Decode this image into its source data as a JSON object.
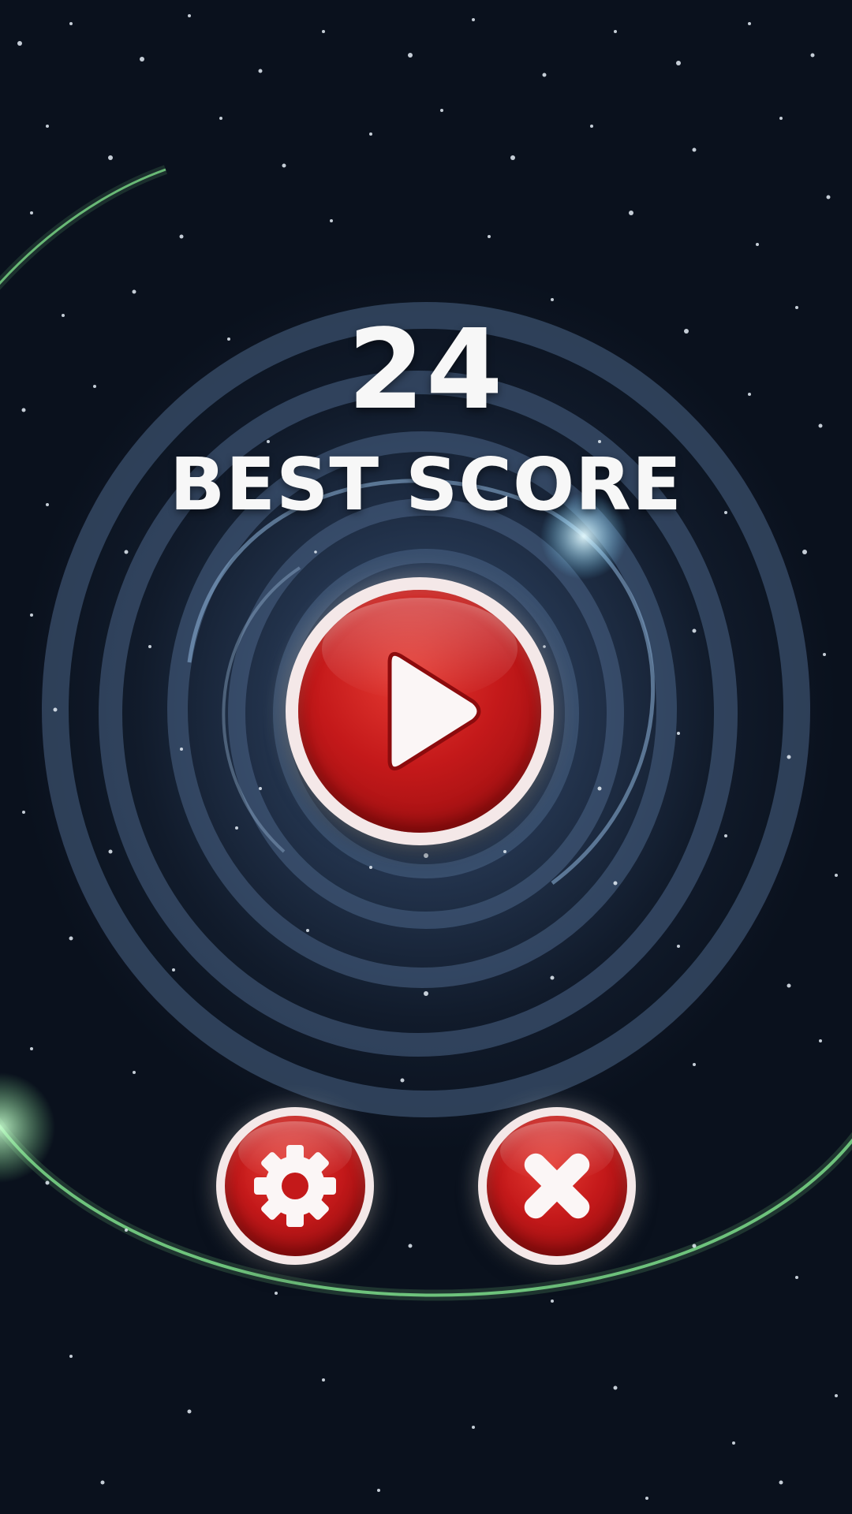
{
  "score": {
    "value": "24",
    "label": "BEST SCORE"
  },
  "buttons": {
    "play_icon": "play-icon",
    "settings_icon": "gear-icon",
    "close_icon": "close-icon"
  },
  "colors": {
    "button_red": "#c4191a",
    "button_rim": "#f4e8e8",
    "text": "#f7f7f7",
    "orbit_green": "#7ddc8a",
    "space_bg": "#0b1320"
  }
}
